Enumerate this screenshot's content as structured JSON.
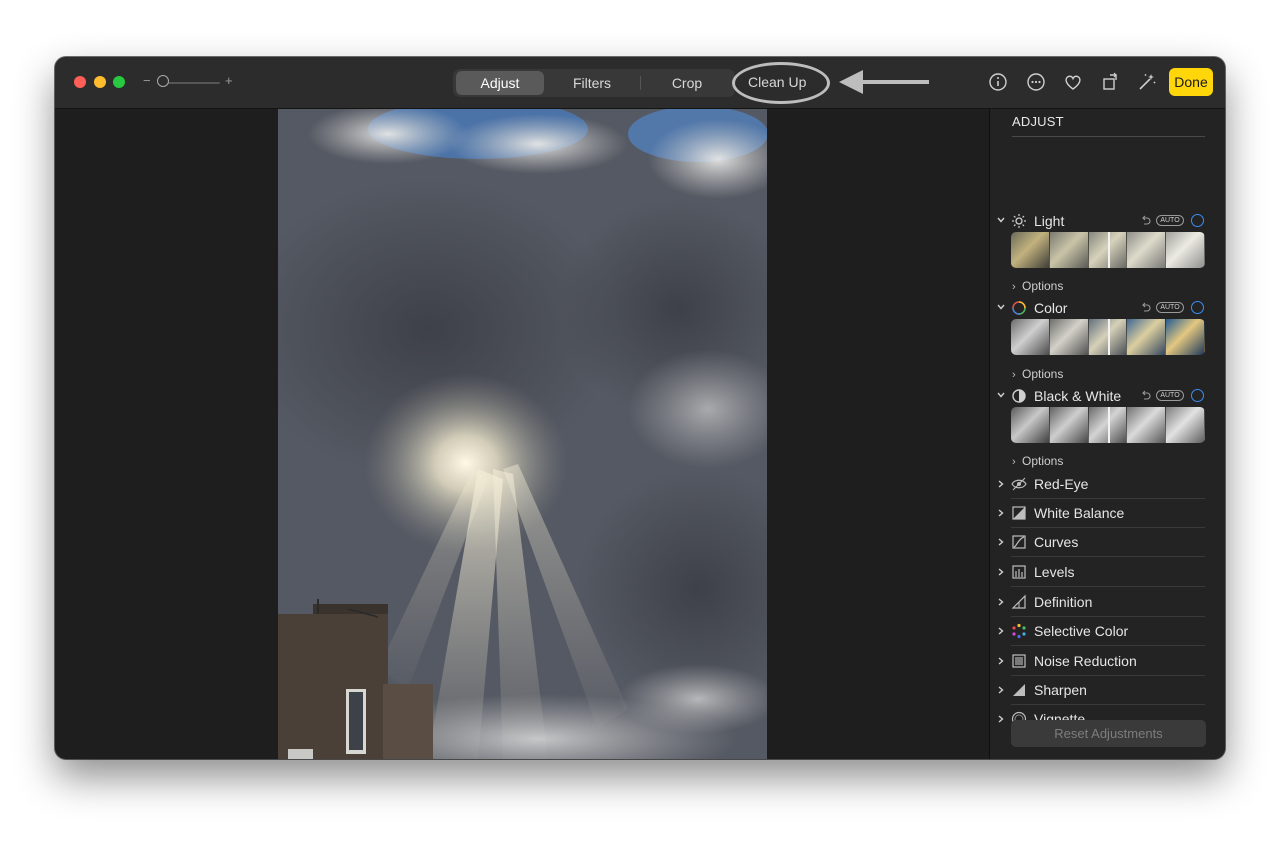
{
  "toolbar": {
    "zoom_minus": "−",
    "zoom_plus": "+",
    "tabs": [
      {
        "label": "Adjust",
        "active": true
      },
      {
        "label": "Filters",
        "active": false
      },
      {
        "label": "Crop",
        "active": false
      }
    ],
    "cleanup_label": "Clean Up",
    "icons": [
      "info-icon",
      "more-icon",
      "heart-icon",
      "rotate-icon",
      "auto-enhance-icon"
    ],
    "done_label": "Done",
    "accent_color": "#ffd60a"
  },
  "sidebar": {
    "title": "ADJUST",
    "sections": [
      {
        "label": "Light",
        "icon": "sun-icon",
        "auto": "AUTO",
        "options": "Options"
      },
      {
        "label": "Color",
        "icon": "color-wheel-icon",
        "auto": "AUTO",
        "options": "Options"
      },
      {
        "label": "Black & White",
        "icon": "half-circle-icon",
        "auto": "AUTO",
        "options": "Options"
      }
    ],
    "items": [
      {
        "label": "Red-Eye",
        "icon": "eye-icon"
      },
      {
        "label": "White Balance",
        "icon": "white-balance-icon"
      },
      {
        "label": "Curves",
        "icon": "curves-icon"
      },
      {
        "label": "Levels",
        "icon": "levels-icon"
      },
      {
        "label": "Definition",
        "icon": "definition-icon"
      },
      {
        "label": "Selective Color",
        "icon": "selective-color-icon"
      },
      {
        "label": "Noise Reduction",
        "icon": "noise-reduction-icon"
      },
      {
        "label": "Sharpen",
        "icon": "sharpen-icon"
      },
      {
        "label": "Vignette",
        "icon": "vignette-icon"
      }
    ],
    "reset_label": "Reset Adjustments",
    "ring_color": "#3a8ef6"
  }
}
